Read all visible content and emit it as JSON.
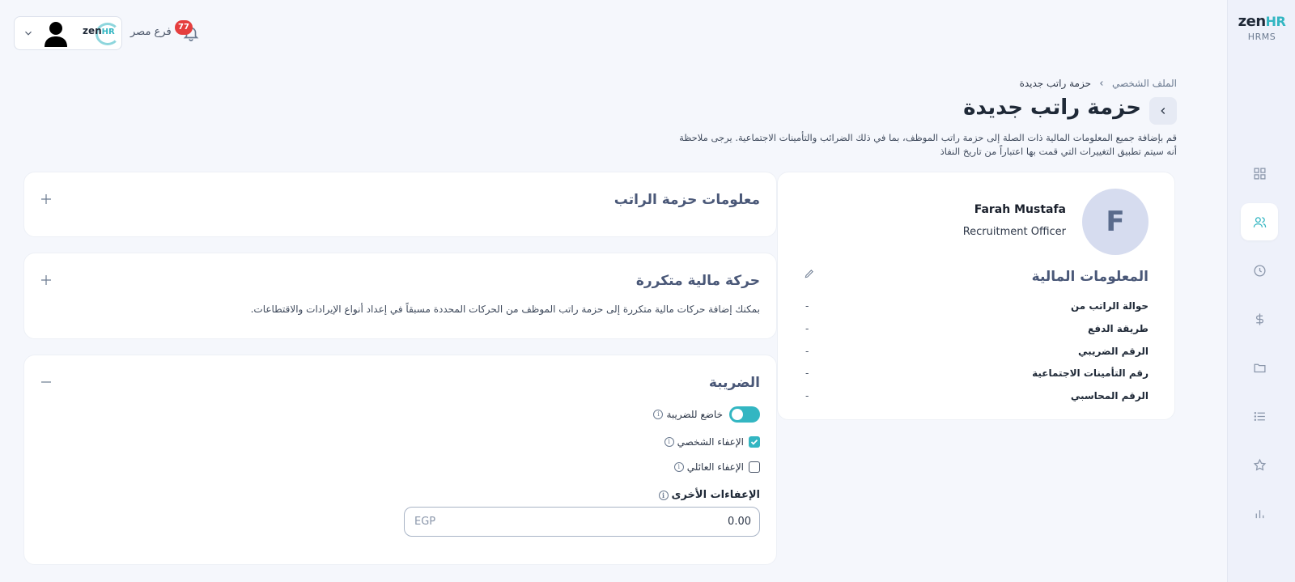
{
  "sidebar": {
    "brand": {
      "logo_main": "zen",
      "logo_accent": "HR",
      "subtitle": "HRMS"
    },
    "items": [
      {
        "icon": "dashboard-grid-icon"
      },
      {
        "icon": "users-icon",
        "active": true
      },
      {
        "icon": "clock-icon"
      },
      {
        "icon": "dollar-icon"
      },
      {
        "icon": "folder-icon"
      },
      {
        "icon": "list-icon"
      },
      {
        "icon": "star-icon"
      },
      {
        "icon": "bar-chart-icon"
      }
    ]
  },
  "topbar": {
    "company_logo_main": "zen",
    "company_logo_accent": "HR",
    "branch": "فرع مصر",
    "notifications_count": "77"
  },
  "header": {
    "breadcrumb_root": "الملف الشخصي",
    "breadcrumb_current": "حزمة راتب جديدة",
    "title": "حزمة راتب جديدة",
    "description": "قم بإضافة جميع المعلومات المالية ذات الصلة إلى حزمة راتب الموظف، بما في ذلك الضرائب والتأمينات الاجتماعية. يرجى ملاحظة أنه سيتم تطبيق التغييرات التي قمت بها اعتباراً من تاريخ النفاذ"
  },
  "employee": {
    "initial": "F",
    "name": "Farah Mustafa",
    "role": "Recruitment Officer",
    "financial_title": "المعلومات المالية",
    "fields": [
      {
        "label": "حوالة الراتب من",
        "value": "-"
      },
      {
        "label": "طريقة الدفع",
        "value": "-"
      },
      {
        "label": "الرقم الضريبي",
        "value": "-"
      },
      {
        "label": "رقم التأمينات الاجتماعية",
        "value": "-"
      },
      {
        "label": "الرقم المحاسبي",
        "value": "-"
      }
    ]
  },
  "sections": {
    "salary_info": {
      "title": "معلومات حزمة الراتب"
    },
    "recurring": {
      "title": "حركة مالية متكررة",
      "description": "بمكنك إضافة حركات مالية متكررة إلى حزمة راتب الموظف من الحركات المحددة مسبقاً في إعداد أنواع الإيرادات والاقتطاعات."
    },
    "tax": {
      "title": "الضريبة",
      "taxable_label": "خاضع للضريبة",
      "taxable": true,
      "personal_exemption_label": "الإعفاء الشخصي",
      "personal_exemption": true,
      "family_exemption_label": "الإعفاء العائلي",
      "family_exemption": false,
      "other_exemptions_label": "الإعفاءات الأخرى",
      "other_exemptions_value": "0.00",
      "currency": "EGP"
    }
  },
  "colors": {
    "accent": "#33b6c2",
    "badge": "#e53e3e",
    "title": "#4a5878"
  }
}
